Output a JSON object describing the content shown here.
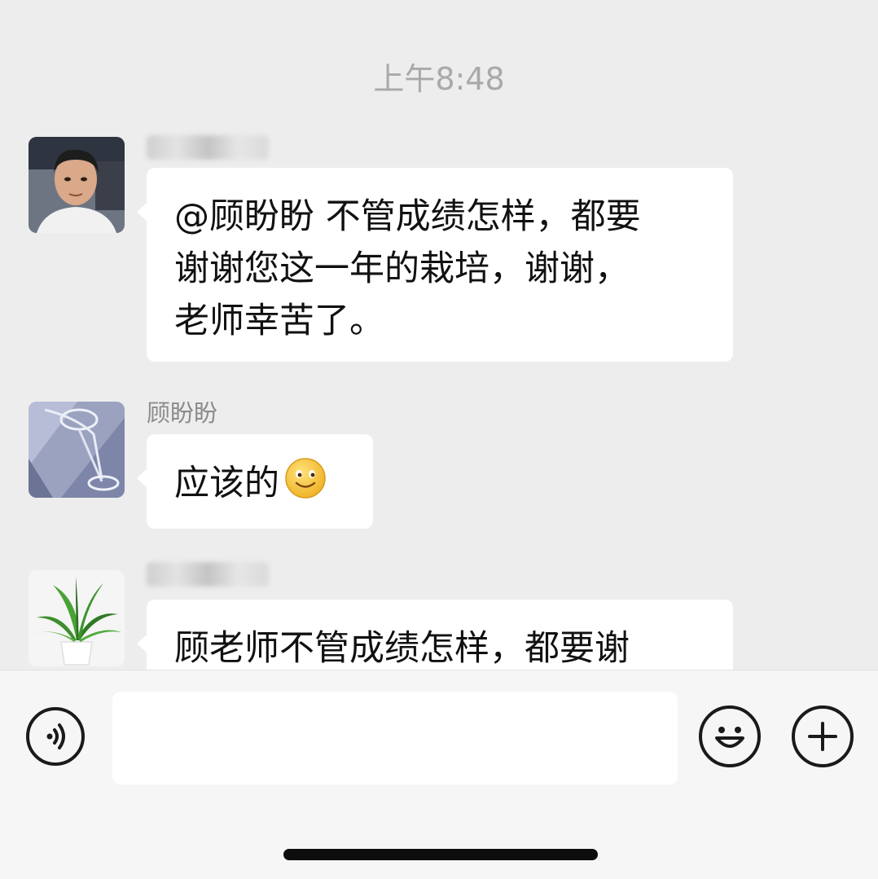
{
  "chat": {
    "timestamp": "上午8:48",
    "messages": [
      {
        "sender": "",
        "sender_redacted": true,
        "avatar": "man-portrait-avatar",
        "lines": [
          "@顾盼盼 不管成绩怎样，都要",
          "谢谢您这一年的栽培，谢谢，",
          "老师幸苦了。"
        ]
      },
      {
        "sender": "顾盼盼",
        "sender_redacted": false,
        "avatar": "glass-photo-avatar",
        "lines": [
          "应该的"
        ],
        "emoji": "smile-emoji"
      },
      {
        "sender": "",
        "sender_redacted": true,
        "avatar": "potted-plant-avatar",
        "lines": [
          "顾老师不管成绩怎样，都要谢"
        ]
      }
    ]
  },
  "input_bar": {
    "text_value": "",
    "voice_icon": "voice-icon",
    "emoji_icon": "emoji-icon",
    "more_icon": "plus-icon"
  },
  "colors": {
    "background": "#ededed",
    "bubble": "#ffffff",
    "timestamp_text": "#a9a9a9"
  }
}
